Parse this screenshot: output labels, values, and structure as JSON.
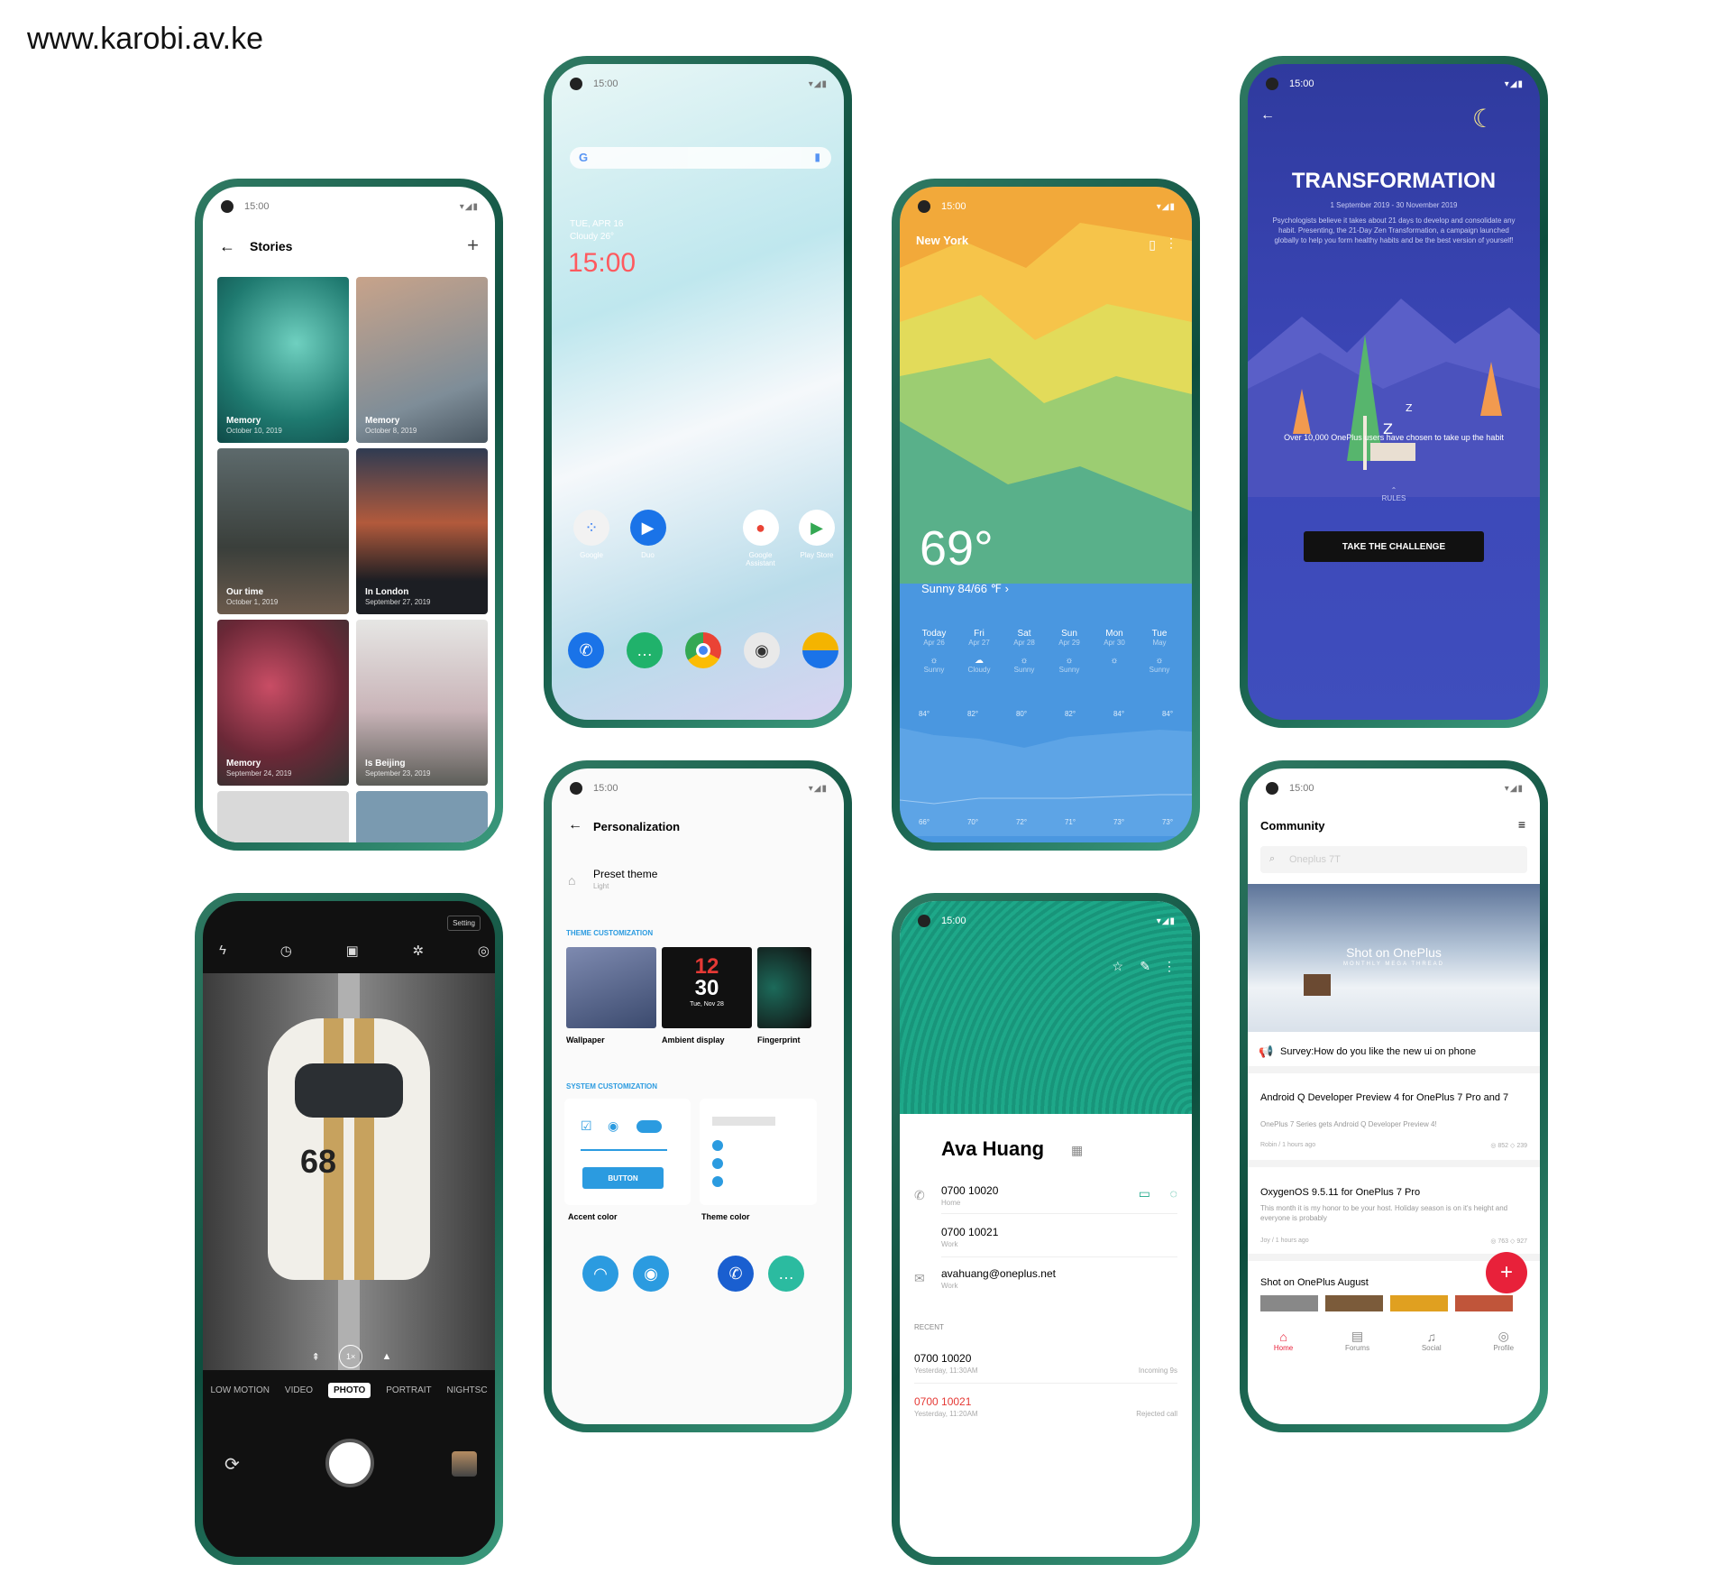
{
  "watermark": "www.karobi.av.ke",
  "status_time": "15:00",
  "gallery": {
    "title": "Stories",
    "tiles": [
      {
        "label": "Memory",
        "date": "October 10, 2019"
      },
      {
        "label": "Memory",
        "date": "October 8, 2019"
      },
      {
        "label": "Our time",
        "date": "October 1, 2019"
      },
      {
        "label": "In London",
        "date": "September 27, 2019"
      },
      {
        "label": "Memory",
        "date": "September 24, 2019"
      },
      {
        "label": "Is Beijing",
        "date": "September 23, 2019"
      }
    ]
  },
  "home": {
    "date": "TUE, APR 16",
    "weather": "Cloudy 26°",
    "clock": "15:00",
    "apps": [
      {
        "label": "Google"
      },
      {
        "label": "Duo"
      },
      {
        "label": "Google Assistant"
      },
      {
        "label": "Play Store"
      }
    ]
  },
  "weather": {
    "city": "New York",
    "temp": "69°",
    "desc": "Sunny 84/66 ℉ ›",
    "days": [
      {
        "d": "Today",
        "date": "Apr 26",
        "c": "Sunny",
        "hi": "84°",
        "lo": "66°"
      },
      {
        "d": "Fri",
        "date": "Apr 27",
        "c": "Cloudy",
        "hi": "82°",
        "lo": "70°"
      },
      {
        "d": "Sat",
        "date": "Apr 28",
        "c": "Sunny",
        "hi": "80°",
        "lo": "72°"
      },
      {
        "d": "Sun",
        "date": "Apr 29",
        "c": "Sunny",
        "hi": "82°",
        "lo": "71°"
      },
      {
        "d": "Mon",
        "date": "Apr 30",
        "c": "",
        "hi": "84°",
        "lo": "73°"
      },
      {
        "d": "Tue",
        "date": "May",
        "c": "Sunny",
        "hi": "84°",
        "lo": "73°"
      }
    ]
  },
  "challenge": {
    "title": "TRANSFORMATION",
    "dates": "1 September 2019 - 30 November 2019",
    "body": "Psychologists believe it takes about 21 days to develop and consolidate any habit. Presenting, the 21-Day Zen Transformation, a campaign launched globally to help you form healthy habits and be the best version of yourself!",
    "stat": "Over 10,000 OnePlus users have chosen to take up the habit",
    "rules": "RULES",
    "cta": "TAKE THE CHALLENGE"
  },
  "personalization": {
    "title": "Personalization",
    "preset": "Preset theme",
    "preset_sub": "Light",
    "theme_header": "THEME CUSTOMIZATION",
    "wallpaper": "Wallpaper",
    "ambient": "Ambient display",
    "fingerprint": "Fingerprint",
    "clock_h": "12",
    "clock_m": "30",
    "clock_date": "Tue, Nov 28",
    "system_header": "SYSTEM CUSTOMIZATION",
    "button": "BUTTON",
    "accent": "Accent color",
    "theme_color": "Theme color"
  },
  "camera": {
    "setting": "Setting",
    "zoom": "1×",
    "modes": [
      "LOW MOTION",
      "VIDEO",
      "PHOTO",
      "PORTRAIT",
      "NIGHTSC"
    ]
  },
  "contact": {
    "name": "Ava Huang",
    "phone1": "0700 10020",
    "phone1_type": "Home",
    "phone2": "0700 10021",
    "phone2_type": "Work",
    "email": "avahuang@oneplus.net",
    "email_type": "Work",
    "recent": "RECENT",
    "r1": "0700 10020",
    "r1_time": "Yesterday, 11:30AM",
    "r1_note": "Incoming 9s",
    "r2": "0700 10021",
    "r2_time": "Yesterday, 11:20AM",
    "r2_note": "Rejected call"
  },
  "community": {
    "title": "Community",
    "search": "Oneplus 7T",
    "banner": "Shot on OnePlus",
    "banner_sub": "MONTHLY MEGA THREAD",
    "survey": "Survey:How do you like the new ui on phone",
    "p1": "Android Q Developer Preview 4 for OnePlus 7 Pro and 7",
    "p1_sub": "OnePlus 7 Series gets Android Q Developer Preview 4!",
    "p1_meta": "Robin / 1 hours ago",
    "p1_stats": "◎ 852   ◇ 239",
    "p2": "OxygenOS 9.5.11 for OnePlus 7 Pro",
    "p2_sub": "This month it is my honor to be your host. Holiday season is on it's height and everyone is probably",
    "p2_meta": "Joy / 1 hours ago",
    "p2_stats": "◎ 763   ◇ 927",
    "section": "Shot on OnePlus August",
    "nav": [
      "Home",
      "Forums",
      "Social",
      "Profile"
    ]
  }
}
